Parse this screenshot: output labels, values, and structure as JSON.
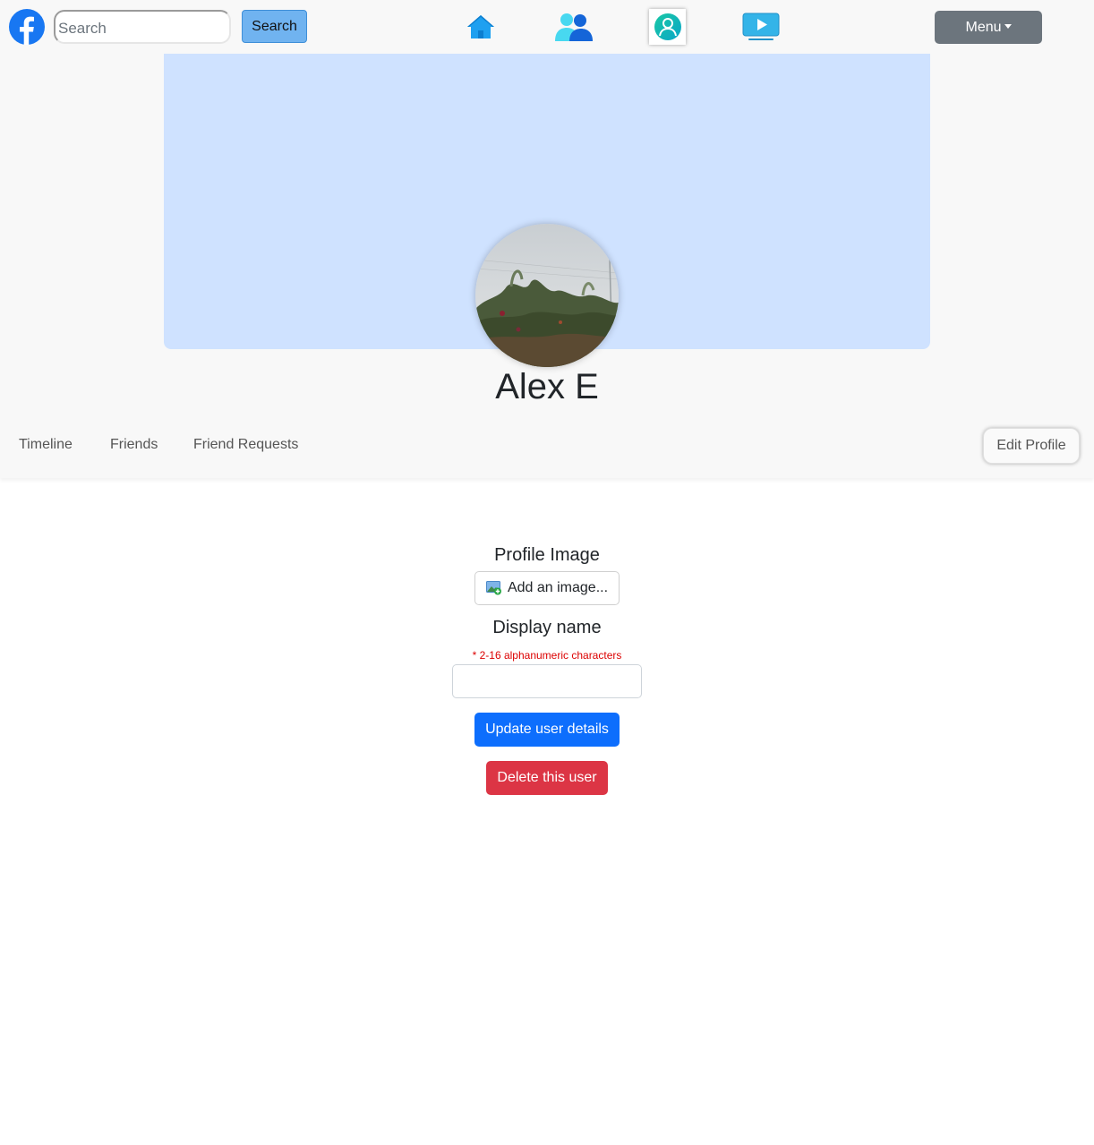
{
  "navbar": {
    "logo_icon": "facebook-logo-icon",
    "search": {
      "placeholder": "Search",
      "value": ""
    },
    "search_button_label": "Search",
    "nav_icons": [
      "home-icon",
      "friends-icon",
      "profile-icon",
      "watch-icon"
    ],
    "active_nav": "profile-icon",
    "menu_label": "Menu"
  },
  "profile": {
    "name": "Alex E",
    "cover_color": "#cfe2ff",
    "tabs": [
      {
        "label": "Timeline"
      },
      {
        "label": "Friends"
      },
      {
        "label": "Friend Requests"
      }
    ],
    "edit_button_label": "Edit Profile"
  },
  "edit_form": {
    "profile_image_label": "Profile Image",
    "add_image_label": "Add an image...",
    "add_image_icon": "add-image-icon",
    "display_name_label": "Display name",
    "display_name_hint": "* 2-16 alphanumeric characters",
    "display_name_value": "",
    "update_button_label": "Update user details",
    "delete_button_label": "Delete this user"
  },
  "colors": {
    "brand_blue": "#1877f2",
    "primary": "#0d6efd",
    "danger": "#dc3545",
    "secondary": "#6c757d",
    "hint_red": "#dc0000"
  }
}
